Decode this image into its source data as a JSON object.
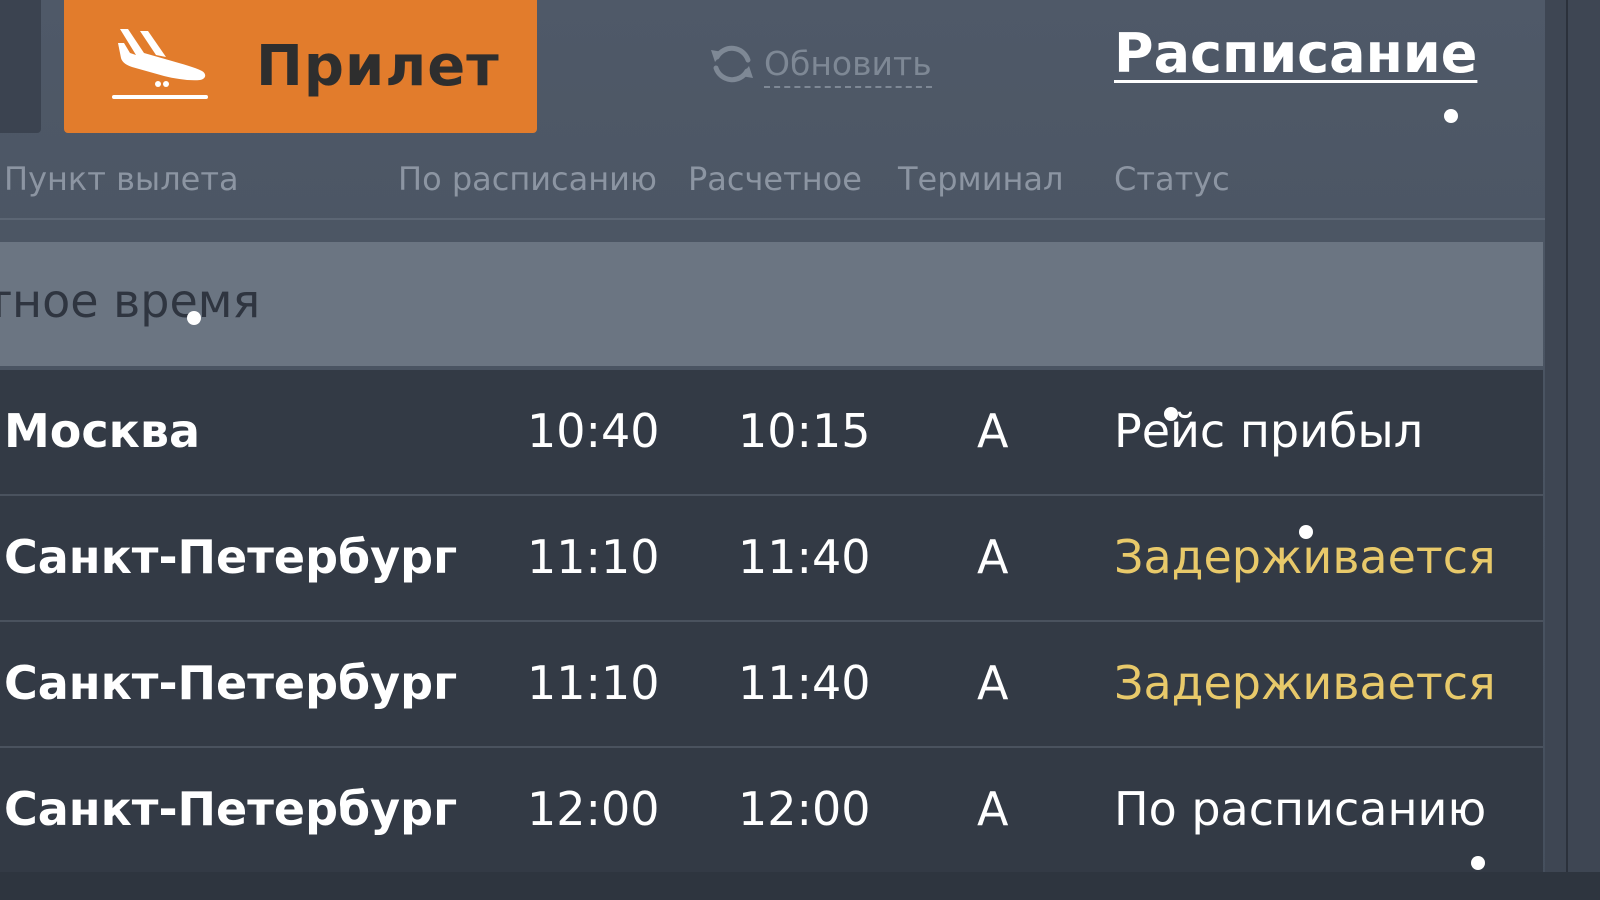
{
  "tabs": {
    "arrival_label": "Прилет",
    "arrival_color": "#e27c2c"
  },
  "refresh_label": "Обновить",
  "schedule_label": "Расписание",
  "columns": {
    "origin": "Пункт вылета",
    "scheduled": "По расписанию",
    "estimated": "Расчетное",
    "terminal": "Терминал",
    "status": "Статус"
  },
  "date_band_text": "ерг, местное время",
  "flights": [
    {
      "origin": "Москва",
      "scheduled": "10:40",
      "estimated": "10:15",
      "terminal": "A",
      "status": "Рейс прибыл",
      "status_color": "#ffffff"
    },
    {
      "origin": "Санкт-Петербург",
      "scheduled": "11:10",
      "estimated": "11:40",
      "terminal": "A",
      "status": "Задерживается",
      "status_color": "#e8c96a"
    },
    {
      "origin": "Санкт-Петербург",
      "scheduled": "11:10",
      "estimated": "11:40",
      "terminal": "A",
      "status": "Задерживается",
      "status_color": "#e8c96a"
    },
    {
      "origin": "Санкт-Петербург",
      "scheduled": "12:00",
      "estimated": "12:00",
      "terminal": "A",
      "status": "По расписанию",
      "status_color": "#ffffff"
    }
  ],
  "icons": {
    "arrival": "plane-landing-icon",
    "refresh": "refresh-icon"
  }
}
